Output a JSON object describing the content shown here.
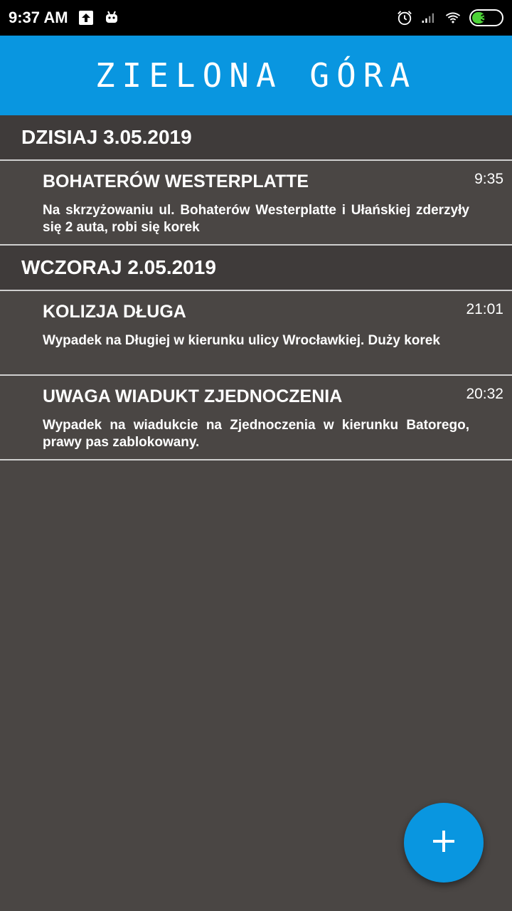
{
  "status_bar": {
    "time": "9:37 AM",
    "battery_level": "38",
    "icons": [
      "upload-icon",
      "android-icon",
      "alarm-icon",
      "signal-icon",
      "wifi-icon",
      "battery-icon"
    ]
  },
  "app_bar": {
    "title": "ZIELONA GÓRA",
    "color": "#0996e0"
  },
  "sections": [
    {
      "header": "DZISIAJ 3.05.2019",
      "items": [
        {
          "title": "BOHATERÓW WESTERPLATTE",
          "time": "9:35",
          "description": "Na skrzyżowaniu ul. Bohaterów Westerplatte i Ułańskiej zderzyły się 2 auta, robi się korek"
        }
      ]
    },
    {
      "header": "WCZORAJ 2.05.2019",
      "items": [
        {
          "title": "KOLIZJA DŁUGA",
          "time": "21:01",
          "description": "Wypadek na Długiej w kierunku ulicy Wrocławkiej. Duży korek"
        },
        {
          "title": "UWAGA WIADUKT ZJEDNOCZENIA",
          "time": "20:32",
          "description": "Wypadek na wiadukcie na Zjednoczenia w kierunku Batorego, prawy pas zablokowany."
        }
      ]
    }
  ],
  "fab": {
    "icon": "plus-icon",
    "color": "#0996e0"
  }
}
